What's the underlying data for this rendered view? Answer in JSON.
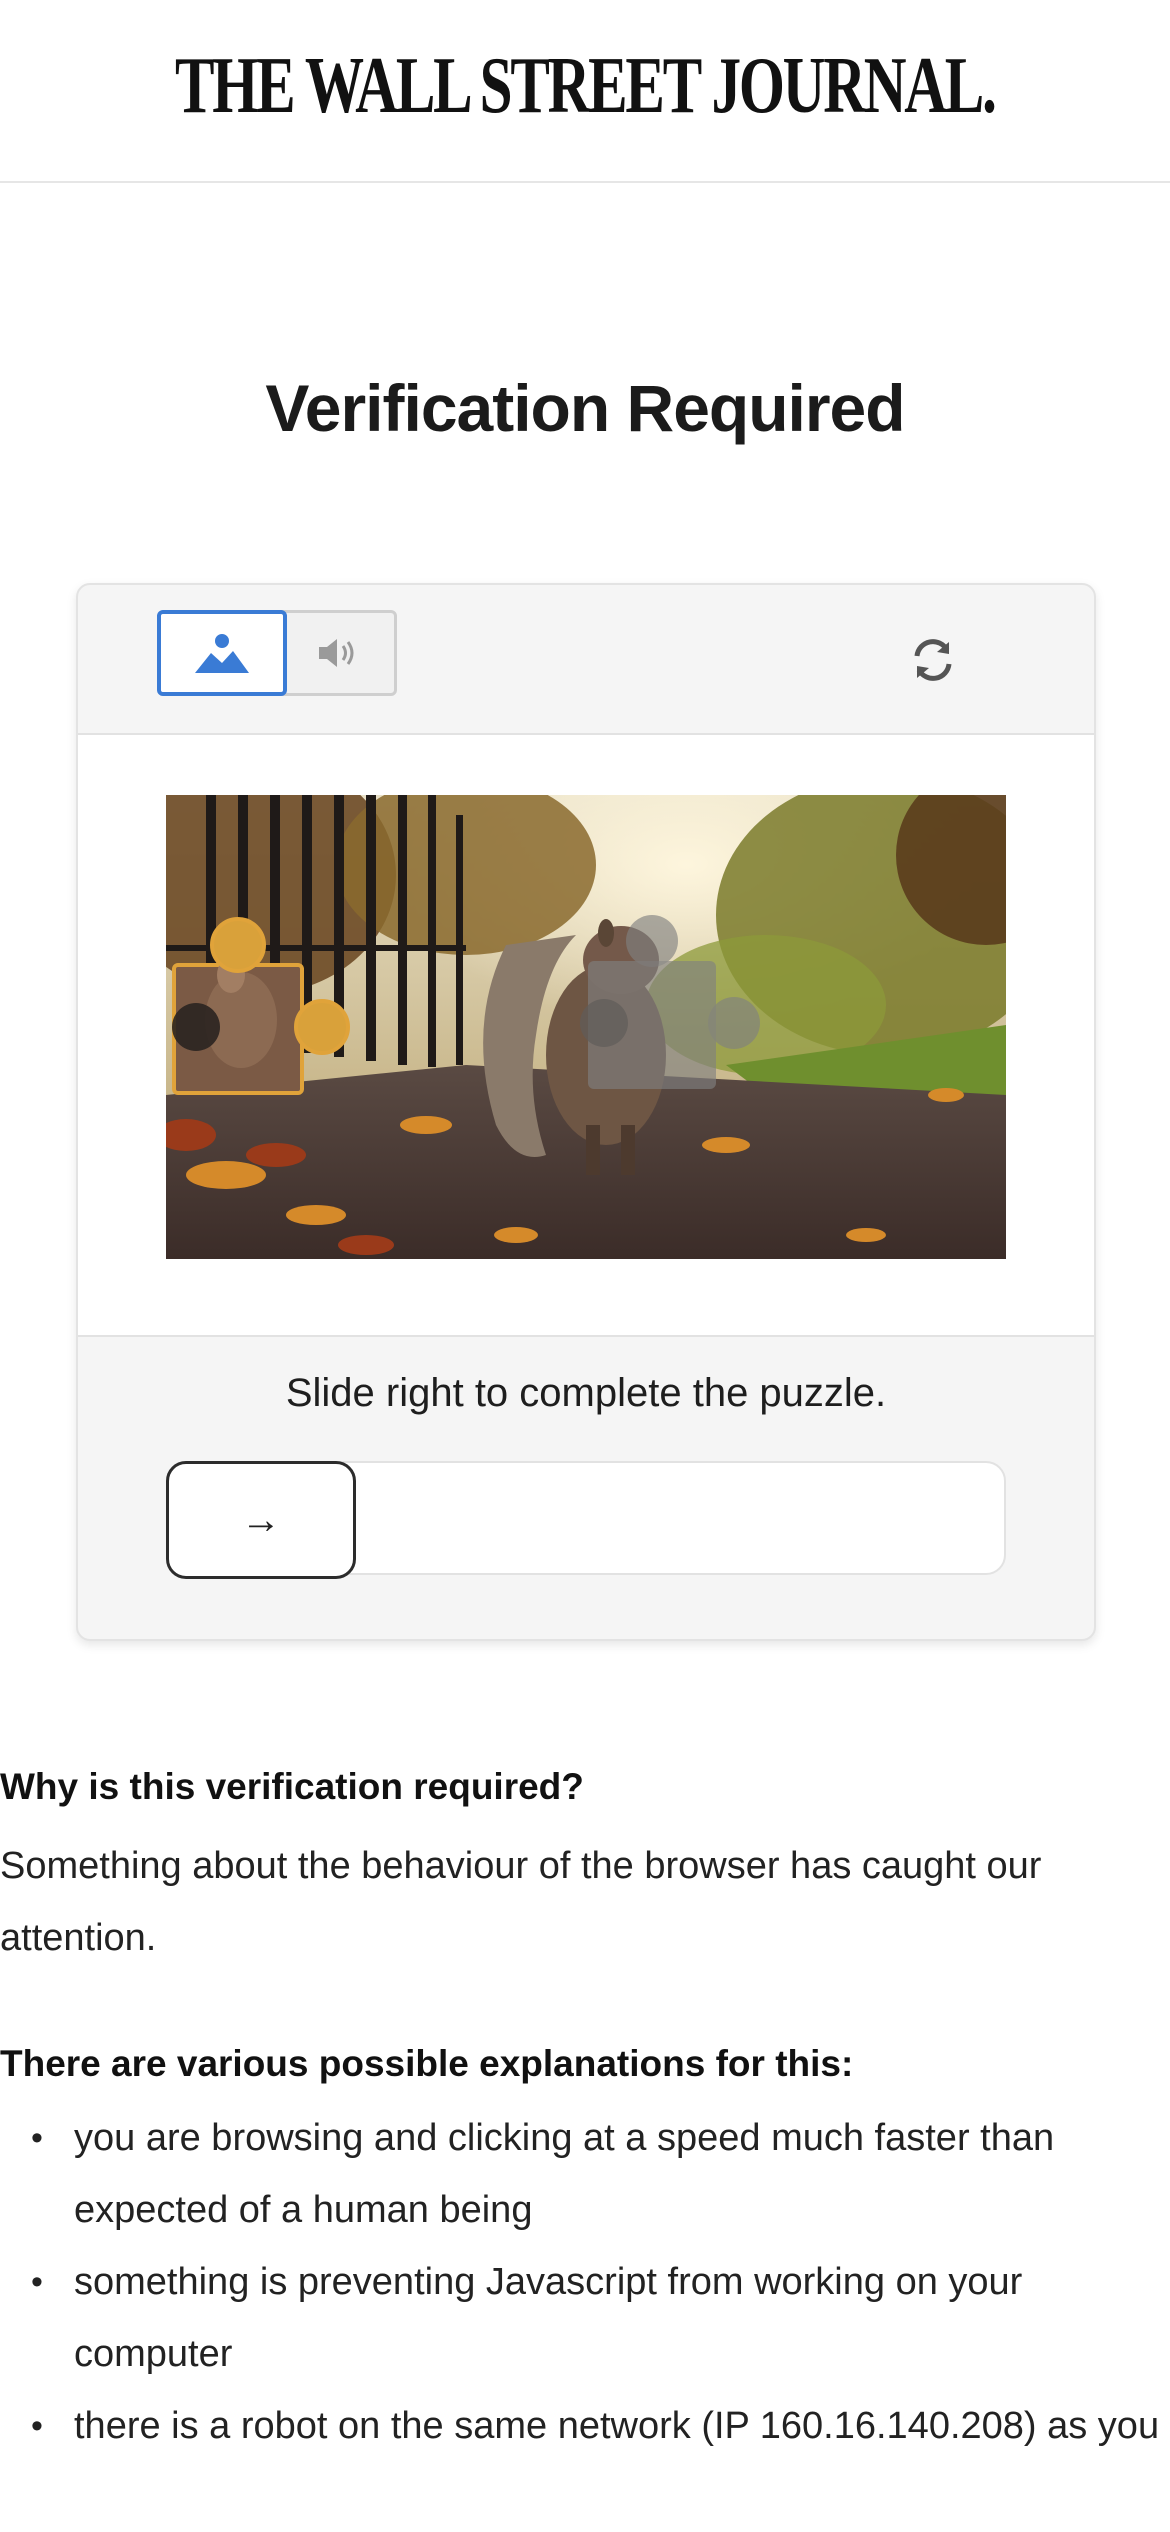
{
  "masthead": {
    "logo_text": "THE WALL STREET JOURNAL."
  },
  "page": {
    "title": "Verification Required"
  },
  "captcha": {
    "modes": [
      {
        "label": "image",
        "icon": "image-mountain-icon",
        "selected": true
      },
      {
        "label": "audio",
        "icon": "speaker-icon",
        "selected": false
      }
    ],
    "refresh_icon": "refresh-icon",
    "instruction": "Slide right to complete the puzzle.",
    "slider": {
      "handle_icon": "arrow-right-icon",
      "handle_glyph": "→",
      "position": 0
    },
    "accent_color": "#3a7bd5",
    "piece_outline_color": "#e0a33a"
  },
  "info": {
    "why_heading": "Why is this verification required?",
    "why_text": "Something about the behaviour of the browser has caught our attention.",
    "reasons_heading": "There are various possible explanations for this:",
    "reasons": [
      "you are browsing and clicking at a speed much faster than expected of a human being",
      "something is preventing Javascript from working on your computer",
      "there is a robot on the same network (IP 160.16.140.208) as you"
    ]
  }
}
